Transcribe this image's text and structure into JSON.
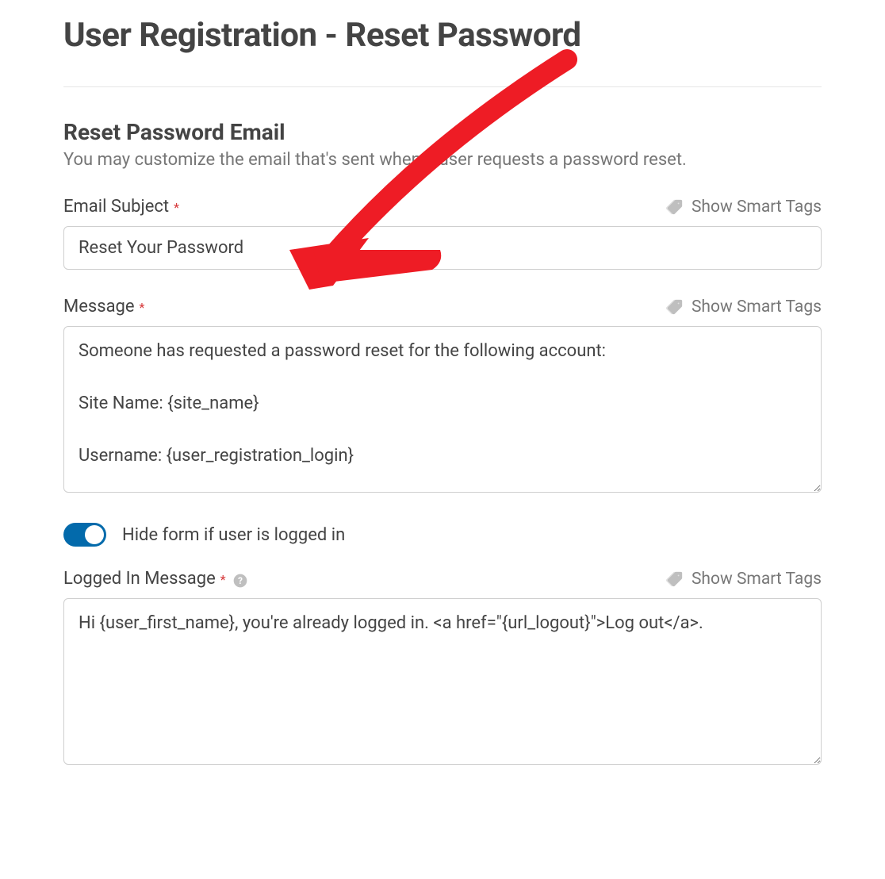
{
  "page": {
    "title": "User Registration - Reset Password"
  },
  "section": {
    "title": "Reset Password Email",
    "description": "You may customize the email that's sent when a user requests a password reset."
  },
  "fields": {
    "email_subject": {
      "label": "Email Subject",
      "value": "Reset Your Password",
      "smart_tags_label": "Show Smart Tags"
    },
    "message": {
      "label": "Message",
      "value": "Someone has requested a password reset for the following account:\n\nSite Name: {site_name}\n\nUsername: {user_registration_login}",
      "smart_tags_label": "Show Smart Tags"
    },
    "hide_toggle": {
      "label": "Hide form if user is logged in",
      "enabled": true
    },
    "logged_in_message": {
      "label": "Logged In Message",
      "value": "Hi {user_first_name}, you're already logged in. <a href=\"{url_logout}\">Log out</a>.",
      "smart_tags_label": "Show Smart Tags"
    }
  }
}
